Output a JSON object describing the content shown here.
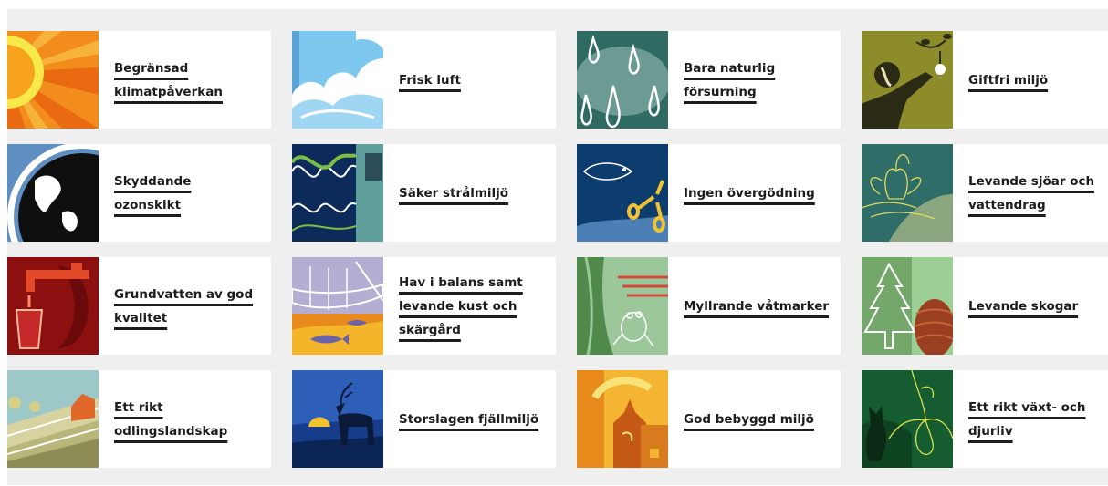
{
  "goals": [
    {
      "label": "Begränsad klimatpåverkan",
      "icon": "sun-icon"
    },
    {
      "label": "Frisk luft",
      "icon": "clouds-icon"
    },
    {
      "label": "Bara naturlig försurning",
      "icon": "raindrops-icon"
    },
    {
      "label": "Giftfri miljö",
      "icon": "person-apple-icon"
    },
    {
      "label": "Skyddande ozonskikt",
      "icon": "globe-icon"
    },
    {
      "label": "Säker strålmiljö",
      "icon": "radiation-waves-icon"
    },
    {
      "label": "Ingen övergödning",
      "icon": "fish-molecule-icon"
    },
    {
      "label": "Levande sjöar och vattendrag",
      "icon": "water-lily-icon"
    },
    {
      "label": "Grundvatten av god kvalitet",
      "icon": "water-tap-icon"
    },
    {
      "label": "Hav i balans samt levande kust och skärgård",
      "icon": "boat-fish-icon"
    },
    {
      "label": "Myllrande våtmarker",
      "icon": "frog-icon"
    },
    {
      "label": "Levande skogar",
      "icon": "spruce-cone-icon"
    },
    {
      "label": "Ett rikt odlingslandskap",
      "icon": "farm-landscape-icon"
    },
    {
      "label": "Storslagen fjällmiljö",
      "icon": "reindeer-icon"
    },
    {
      "label": "God bebyggd miljö",
      "icon": "buildings-icon"
    },
    {
      "label": "Ett rikt växt- och djurliv",
      "icon": "lynx-orchid-icon"
    }
  ],
  "colors": {
    "panel_background": "#efefef",
    "card_background": "#ffffff",
    "label_text": "#1d1d1d"
  }
}
